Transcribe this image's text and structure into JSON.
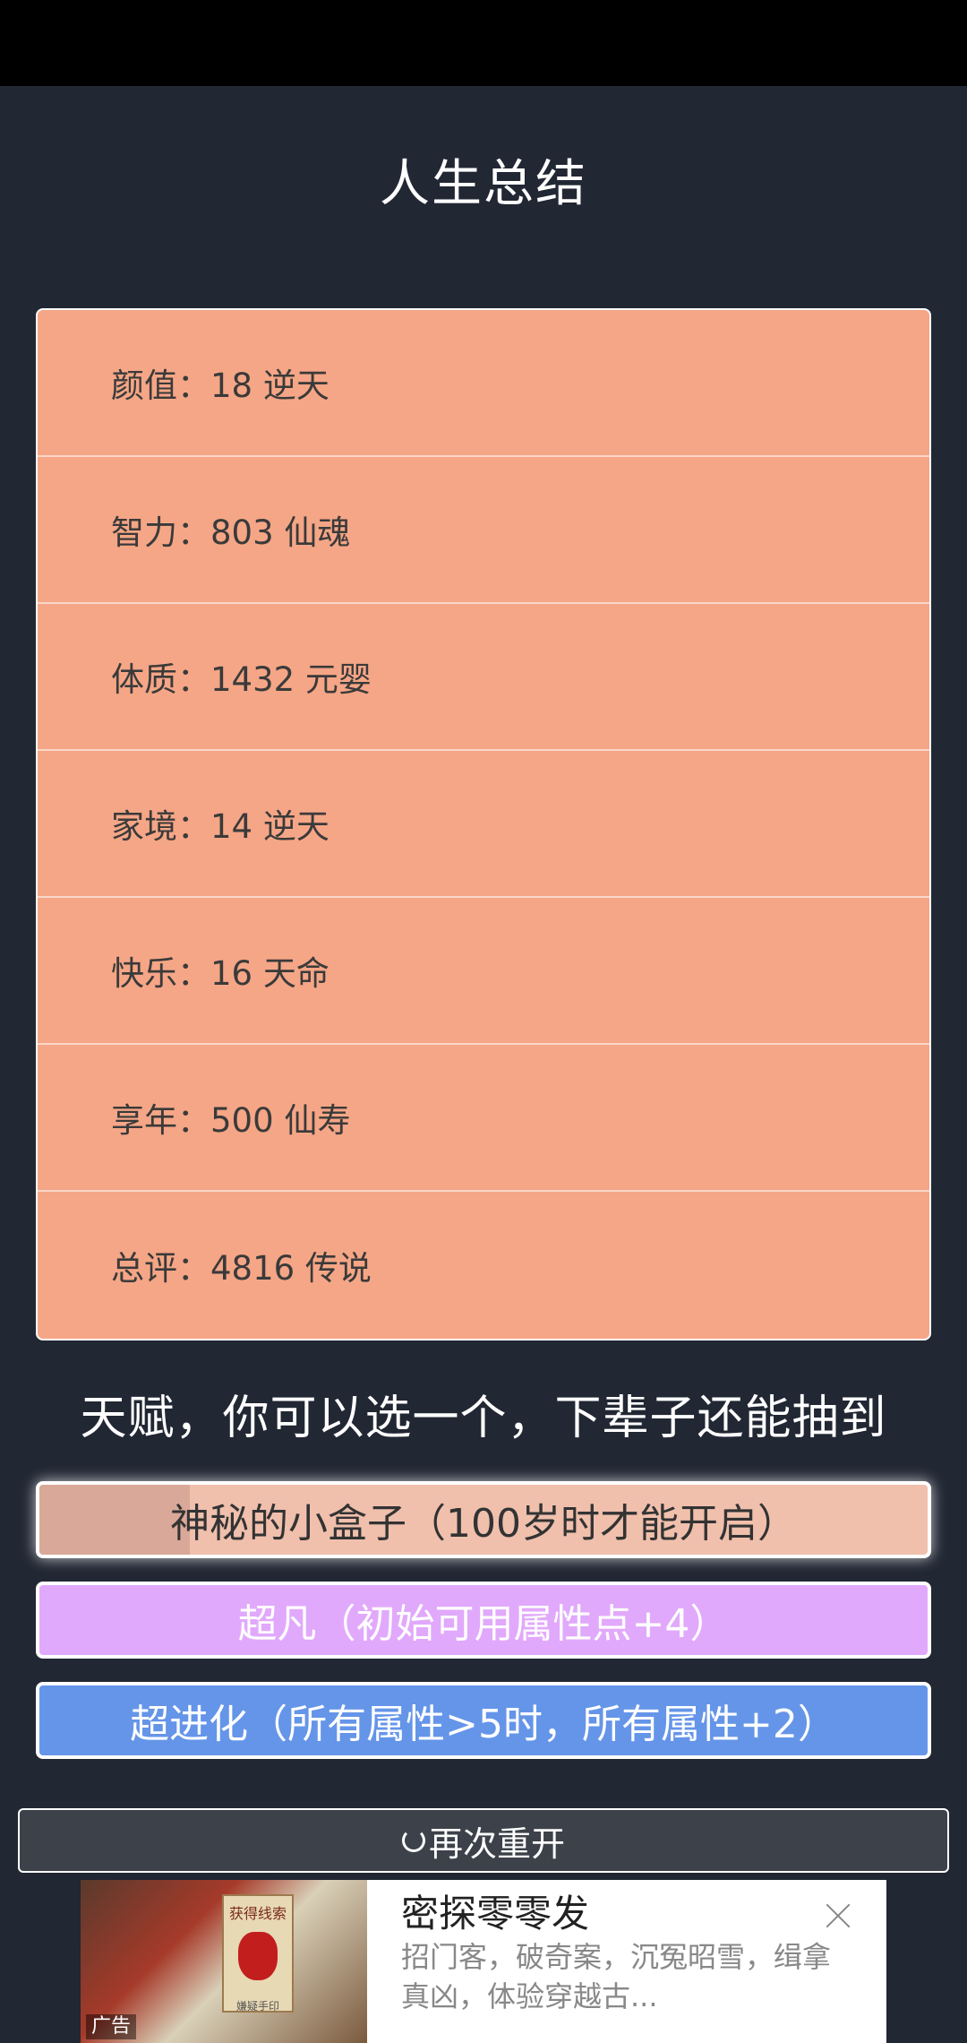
{
  "header": {
    "title": "人生总结"
  },
  "summary": [
    {
      "label": "颜值：18 逆天"
    },
    {
      "label": "智力：803 仙魂"
    },
    {
      "label": "体质：1432 元婴"
    },
    {
      "label": "家境：14 逆天"
    },
    {
      "label": "快乐：16 天命"
    },
    {
      "label": "享年：500 仙寿"
    },
    {
      "label": "总评：4816 传说"
    }
  ],
  "talents": {
    "prompt": "天赋，你可以选一个，下辈子还能抽到",
    "options": [
      {
        "label": "神秘的小盒子（100岁时才能开启）",
        "color": "#f0c0ad"
      },
      {
        "label": "超凡（初始可用属性点+4）",
        "color": "#e1a9fb"
      },
      {
        "label": "超进化（所有属性>5时，所有属性+2）",
        "color": "#6595e8"
      }
    ]
  },
  "restart": {
    "label": "再次重开",
    "icon": "restart-icon"
  },
  "ad": {
    "badge": "广告",
    "card_title": "获得线索",
    "card_sub": "嫌疑手印",
    "name": "密探零零发",
    "desc": "招门客，破奇案，沉冤昭雪，缉拿真凶，体验穿越古..."
  }
}
